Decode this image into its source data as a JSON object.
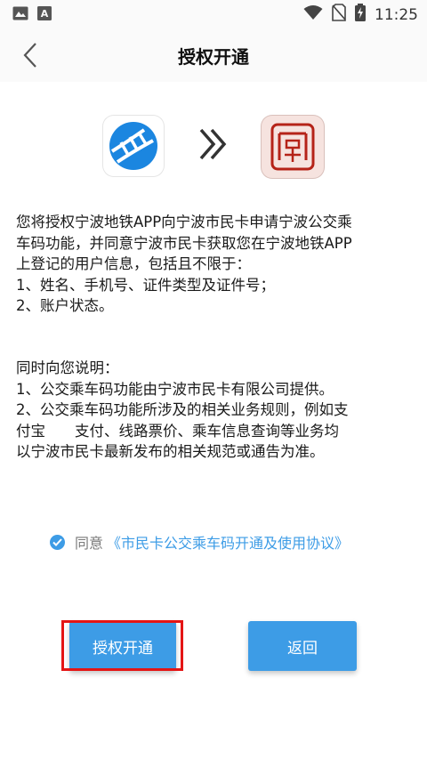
{
  "status_bar": {
    "time": "11:25"
  },
  "header": {
    "title": "授权开通"
  },
  "description": {
    "lines": [
      "您将授权宁波地铁APP向宁波市民卡申请宁波公交乘",
      "车码功能，并同意宁波市民卡获取您在宁波地铁APP",
      "上登记的用户信息，包括且不限于：",
      "1、姓名、手机号、证件类型及证件号；",
      "2、账户状态。"
    ]
  },
  "notice": {
    "lines": [
      "同时向您说明：",
      "1、公交乘车码功能由宁波市民卡有限公司提供。",
      "2、公交乘车码功能所涉及的相关业务规则，例如支",
      "付宝　　支付、线路票价、乘车信息查询等业务均",
      "以宁波市民卡最新发布的相关规范或通告为准。"
    ]
  },
  "agreement": {
    "label": "同意",
    "link": "《市民卡公交乘车码开通及使用协议》",
    "checked": true
  },
  "buttons": {
    "authorize": "授权开通",
    "back": "返回"
  },
  "colors": {
    "accent": "#3d9ce6",
    "highlight": "#e41515"
  }
}
